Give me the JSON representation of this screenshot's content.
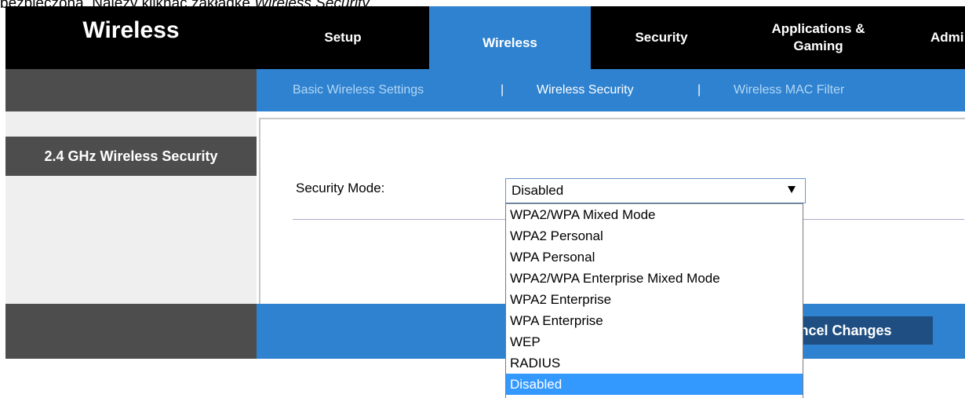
{
  "caption": {
    "pre": "bezpieczona. Należy kliknąć zakładkę ",
    "em": "Wireless Security",
    "post": "."
  },
  "header": {
    "title": "Wireless",
    "tabs": [
      {
        "label": "Setup"
      },
      {
        "label": "Wireless"
      },
      {
        "label": "Security"
      },
      {
        "label": "Applications &",
        "label2": "Gaming"
      },
      {
        "label": "Admi"
      }
    ]
  },
  "subnav": {
    "items": [
      "Basic Wireless Settings",
      "Wireless Security",
      "Wireless MAC Filter"
    ],
    "separator": "|"
  },
  "side": {
    "heading": "2.4 GHz Wireless Security"
  },
  "form": {
    "label": "Security Mode:",
    "selected_value": "Disabled",
    "options": [
      "WPA2/WPA Mixed Mode",
      "WPA2 Personal",
      "WPA Personal",
      "WPA2/WPA Enterprise Mixed Mode",
      "WPA2 Enterprise",
      "WPA Enterprise",
      "WEP",
      "RADIUS",
      "Disabled"
    ]
  },
  "footer": {
    "cancel_label": "ncel Changes"
  },
  "colors": {
    "header_bg": "#000000",
    "accent_blue": "#2f82cf",
    "dark_gray": "#4d4d4d",
    "subnav_inactive": "#b3d7f7",
    "selected_option": "#3399ff",
    "button_dark_blue": "#1f4f82"
  }
}
